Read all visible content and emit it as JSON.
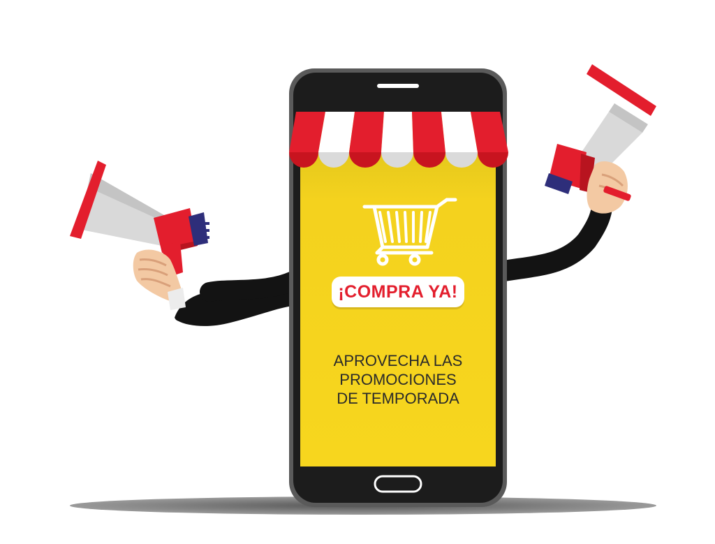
{
  "ad": {
    "cta_label": "¡COMPRA YA!",
    "promo_lines": [
      "APROVECHA LAS",
      "PROMOCIONES",
      "DE TEMPORADA"
    ]
  },
  "colors": {
    "red": "#e31e2d",
    "yellow": "#f6d21b",
    "phone_body": "#1c1c1c",
    "awning_white": "#ffffff",
    "megaphone_cone": "#d9d9d9",
    "skin": "#f3c9a3",
    "shadow": "#6e6e6e"
  },
  "icons": [
    "shopping-cart-icon",
    "megaphone-icon",
    "store-awning",
    "home-button"
  ]
}
